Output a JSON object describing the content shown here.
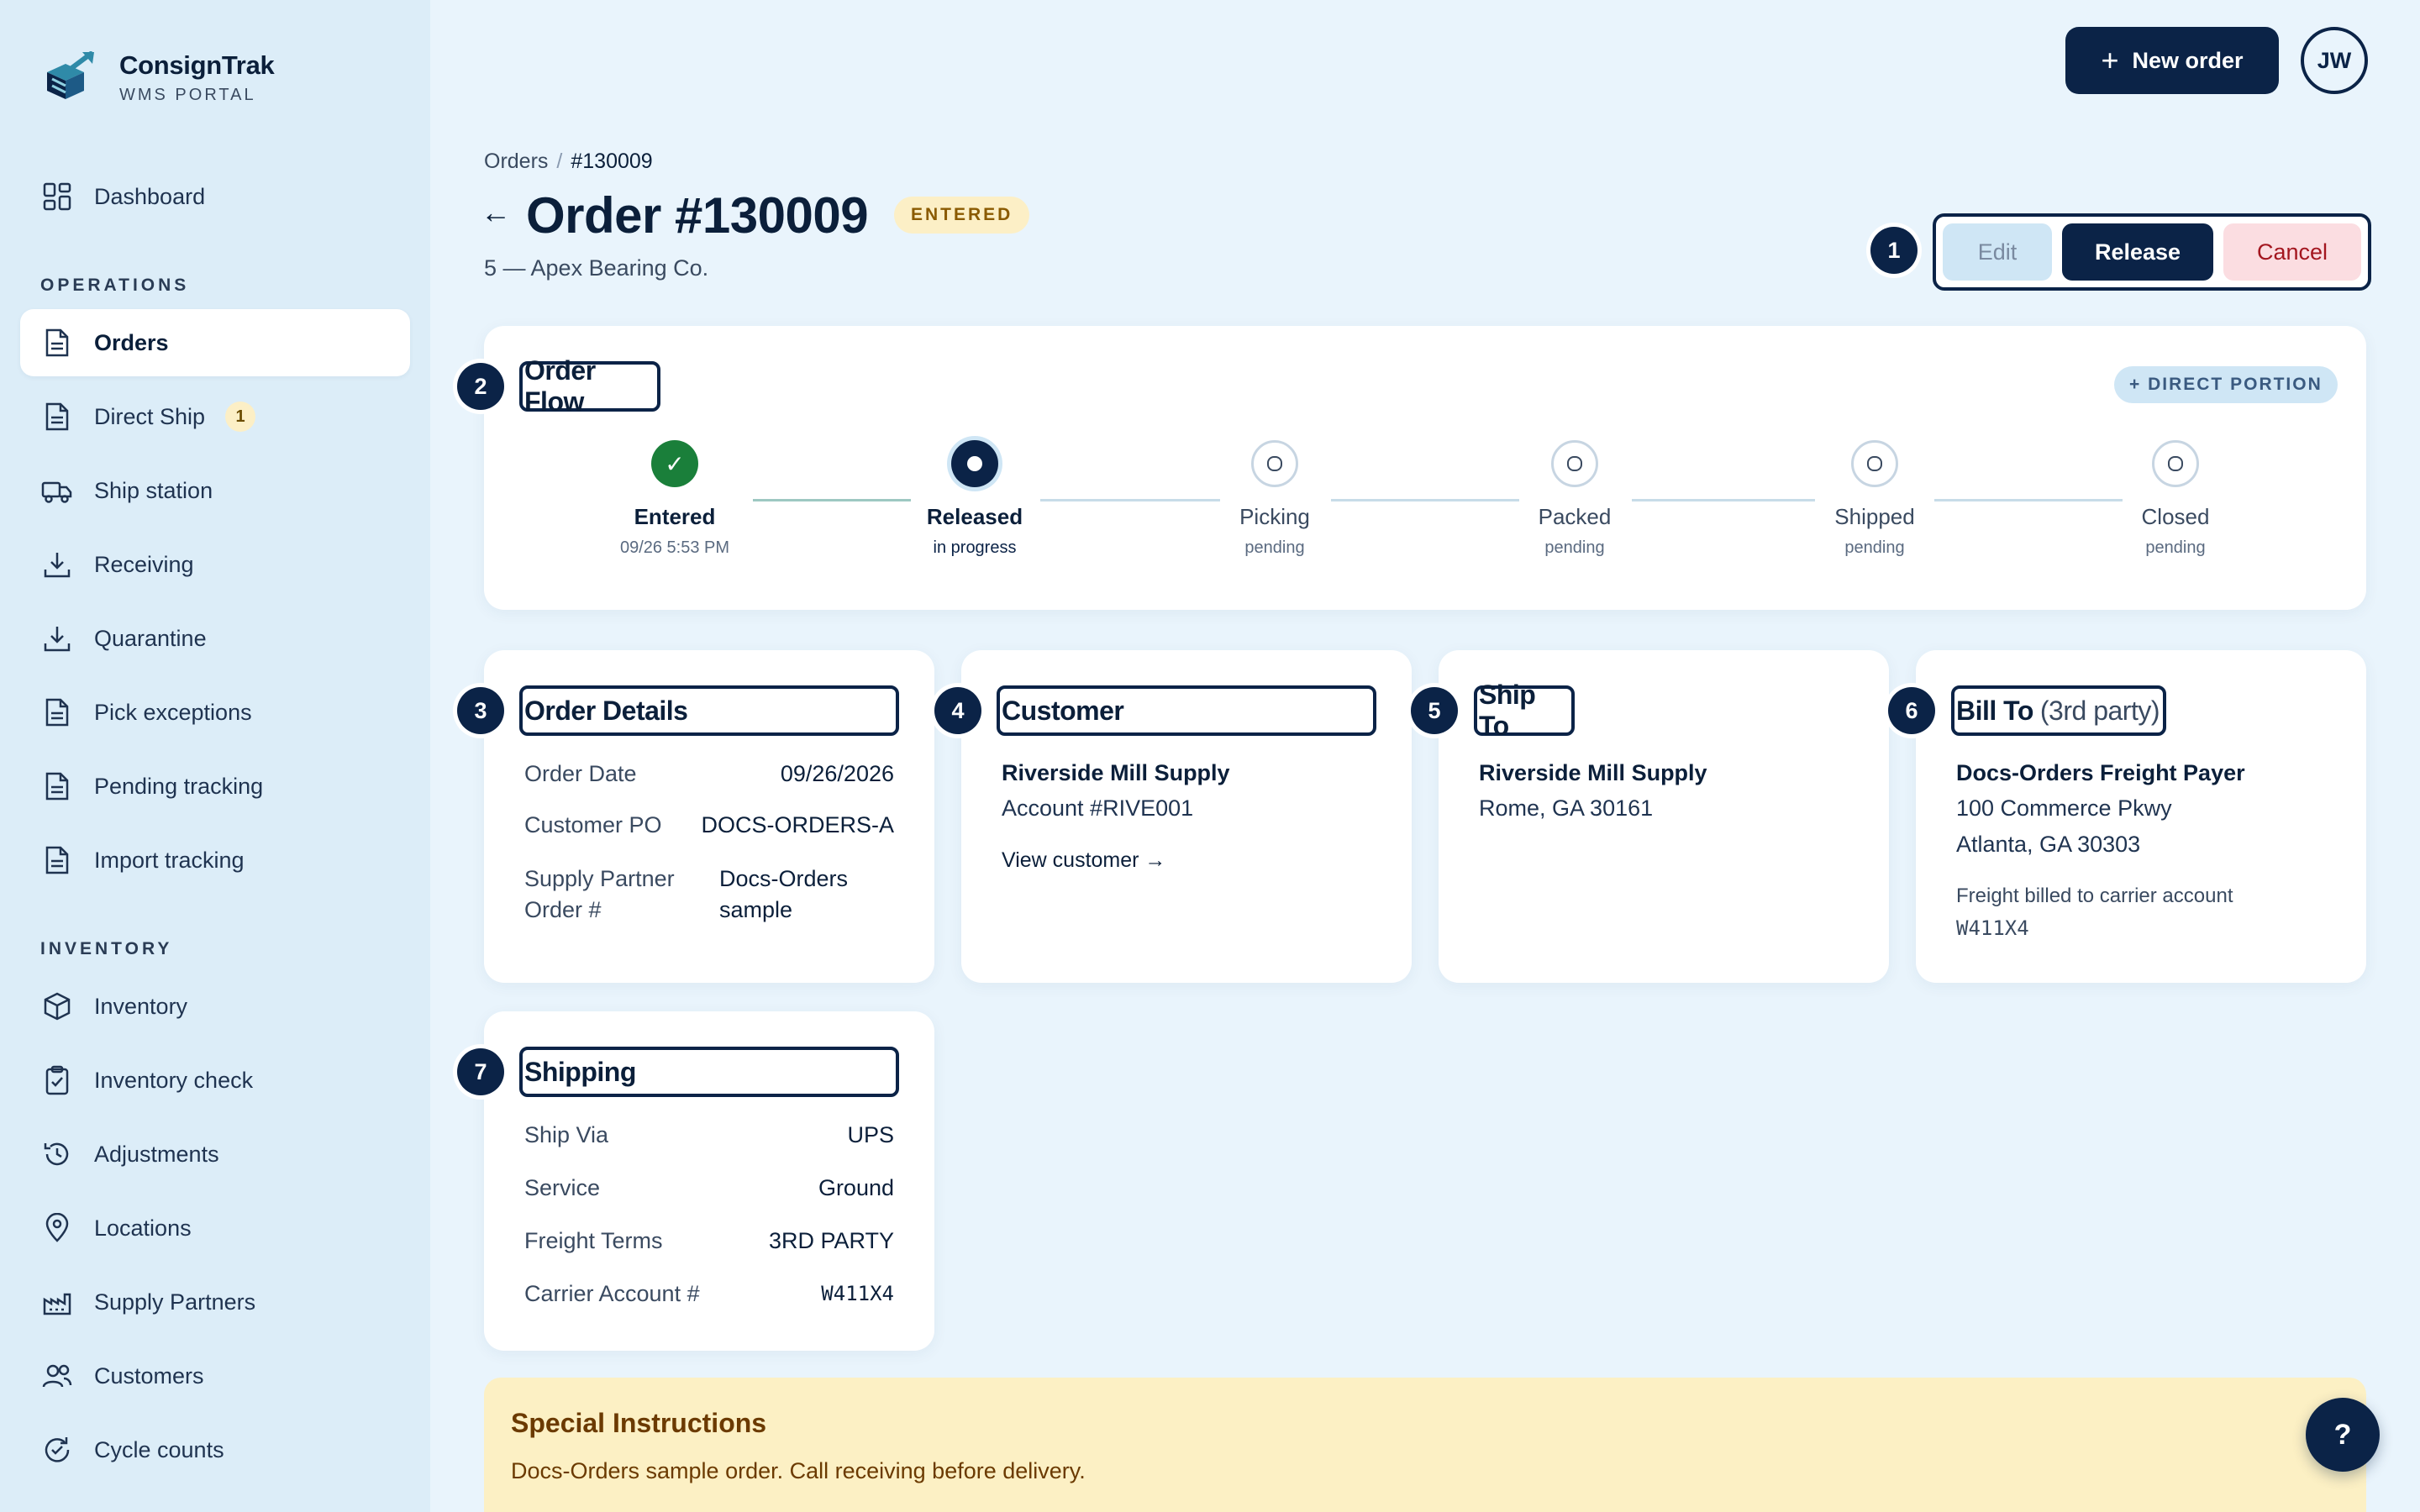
{
  "brand": {
    "name": "ConsignTrak",
    "subtitle": "WMS PORTAL"
  },
  "sidebar": {
    "items_top": [
      {
        "label": "Dashboard",
        "icon": "grid-icon"
      }
    ],
    "operations_label": "OPERATIONS",
    "operations": [
      {
        "label": "Orders",
        "icon": "document-icon",
        "active": true
      },
      {
        "label": "Direct Ship",
        "icon": "document-icon",
        "badge": "1"
      },
      {
        "label": "Ship station",
        "icon": "truck-icon"
      },
      {
        "label": "Receiving",
        "icon": "download-icon"
      },
      {
        "label": "Quarantine",
        "icon": "download-icon"
      },
      {
        "label": "Pick exceptions",
        "icon": "document-icon"
      },
      {
        "label": "Pending tracking",
        "icon": "document-icon"
      },
      {
        "label": "Import tracking",
        "icon": "document-icon"
      }
    ],
    "inventory_label": "INVENTORY",
    "inventory": [
      {
        "label": "Inventory",
        "icon": "cube-icon"
      },
      {
        "label": "Inventory check",
        "icon": "clipboard-check-icon"
      },
      {
        "label": "Adjustments",
        "icon": "history-icon"
      },
      {
        "label": "Locations",
        "icon": "map-pin-icon"
      },
      {
        "label": "Supply Partners",
        "icon": "factory-icon"
      },
      {
        "label": "Customers",
        "icon": "users-icon"
      },
      {
        "label": "Cycle counts",
        "icon": "refresh-check-icon"
      }
    ]
  },
  "topbar": {
    "new_order_label": "New order",
    "avatar_initials": "JW"
  },
  "header": {
    "breadcrumb": [
      "Orders",
      "#130009"
    ],
    "breadcrumb_sep": "/",
    "title": "Order #130009",
    "status": "ENTERED",
    "subtitle": "5 — Apex Bearing Co."
  },
  "actions": {
    "edit": "Edit",
    "release": "Release",
    "cancel": "Cancel"
  },
  "markers": [
    "1",
    "2",
    "3",
    "4",
    "5",
    "6",
    "7"
  ],
  "flow": {
    "title": "Order Flow",
    "direct_portion": "+ DIRECT PORTION",
    "steps": [
      {
        "label": "Entered",
        "sub": "09/26 5:53 PM",
        "state": "done"
      },
      {
        "label": "Released",
        "sub": "in progress",
        "state": "current"
      },
      {
        "label": "Picking",
        "sub": "pending",
        "state": "pending"
      },
      {
        "label": "Packed",
        "sub": "pending",
        "state": "pending"
      },
      {
        "label": "Shipped",
        "sub": "pending",
        "state": "pending"
      },
      {
        "label": "Closed",
        "sub": "pending",
        "state": "pending"
      }
    ],
    "done_check": "✓"
  },
  "order_details": {
    "title": "Order Details",
    "rows": [
      {
        "label": "Order Date",
        "value": "09/26/2026"
      },
      {
        "label": "Customer PO",
        "value": "DOCS-ORDERS-A"
      },
      {
        "label": "Supply Partner\nOrder #",
        "value": "Docs-Orders\nsample"
      }
    ]
  },
  "customer": {
    "title": "Customer",
    "name": "Riverside Mill Supply",
    "account": "Account #RIVE001",
    "link": "View customer →"
  },
  "ship_to": {
    "title": "Ship To",
    "name": "Riverside Mill Supply",
    "address": "Rome, GA 30161"
  },
  "bill_to": {
    "title": "Bill To",
    "title_suffix": "(3rd party)",
    "name": "Docs-Orders Freight Payer",
    "line1": "100 Commerce Pkwy",
    "line2": "Atlanta, GA 30303",
    "note": "Freight billed to carrier account",
    "account": "W411X4"
  },
  "shipping": {
    "title": "Shipping",
    "rows": [
      {
        "label": "Ship Via",
        "value": "UPS"
      },
      {
        "label": "Service",
        "value": "Ground"
      },
      {
        "label": "Freight Terms",
        "value": "3RD PARTY"
      },
      {
        "label": "Carrier Account #",
        "value": "W411X4"
      }
    ]
  },
  "special_instructions": {
    "title": "Special Instructions",
    "body": "Docs-Orders sample order. Call receiving before delivery."
  },
  "help_label": "?",
  "colors": {
    "navy": "#0b2347",
    "success": "#1a7f3a",
    "warning_bg": "#fcefc6",
    "danger": "#a3161f",
    "page_bg": "#e9f4fc",
    "sidebar_bg": "#dcedf8"
  }
}
